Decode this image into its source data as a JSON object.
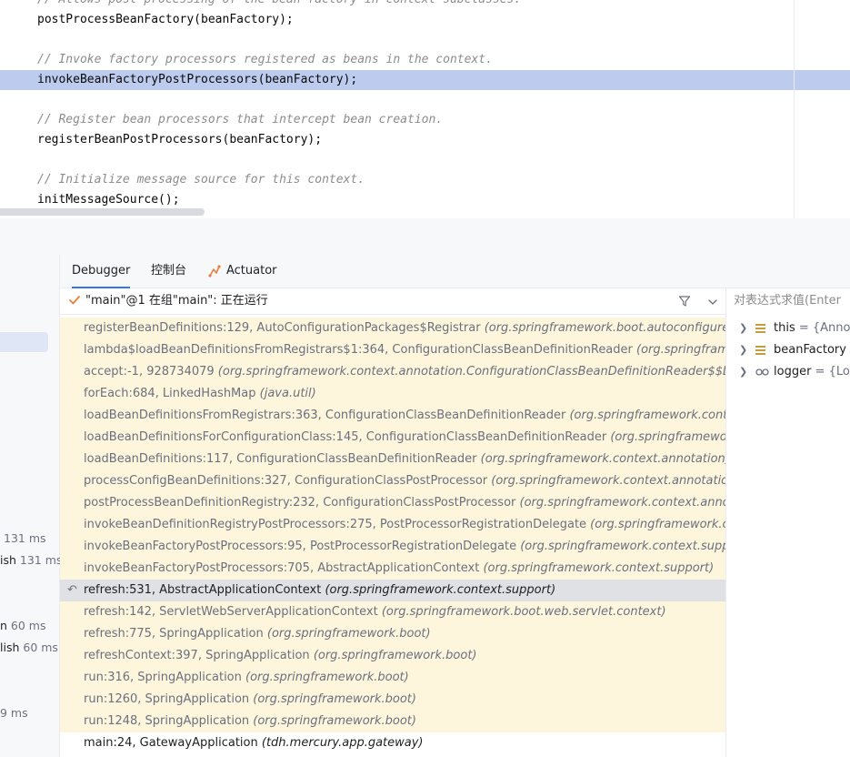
{
  "editor": {
    "lines": [
      {
        "text": "// Allows post-processing of the bean factory in context subclasses.",
        "type": "comment"
      },
      {
        "text": "postProcessBeanFactory(beanFactory);",
        "type": "code"
      },
      {
        "text": "// Invoke factory processors registered as beans in the context.",
        "type": "comment"
      },
      {
        "text": "invokeBeanFactoryPostProcessors(beanFactory);",
        "type": "code",
        "highlighted": true
      },
      {
        "text": "// Register bean processors that intercept bean creation.",
        "type": "comment"
      },
      {
        "text": "registerBeanPostProcessors(beanFactory);",
        "type": "code"
      },
      {
        "text": "// Initialize message source for this context.",
        "type": "comment"
      },
      {
        "text": "initMessageSource();",
        "type": "code"
      }
    ]
  },
  "tabs": [
    {
      "label": "Debugger",
      "active": true
    },
    {
      "label": "控制台",
      "active": false
    },
    {
      "label": "Actuator",
      "active": false
    }
  ],
  "thread": {
    "label": "\"main\"@1 在组\"main\": 正在运行"
  },
  "left_panel": {
    "timings": [
      {
        "prefix": "",
        "ms": "131 ms"
      },
      {
        "prefix": "ish",
        "ms": "131 ms"
      },
      {
        "prefix": "n",
        "ms": "60 ms"
      },
      {
        "prefix": "lish",
        "ms": "60 ms"
      },
      {
        "prefix": "",
        "ms": "9 ms"
      }
    ]
  },
  "frames": [
    {
      "method": "registerBeanDefinitions:129, AutoConfigurationPackages$Registrar ",
      "package": "(org.springframework.boot.autoconfigure)",
      "kind": "lib"
    },
    {
      "method": "lambda$loadBeanDefinitionsFromRegistrars$1:364, ConfigurationClassBeanDefinitionReader ",
      "package": "(org.springframework.context.annotation)",
      "kind": "lib"
    },
    {
      "method": "accept:-1, 928734079 ",
      "package": "(org.springframework.context.annotation.ConfigurationClassBeanDefinitionReader$$Lambda)",
      "kind": "lib"
    },
    {
      "method": "forEach:684, LinkedHashMap ",
      "package": "(java.util)",
      "kind": "lib"
    },
    {
      "method": "loadBeanDefinitionsFromRegistrars:363, ConfigurationClassBeanDefinitionReader ",
      "package": "(org.springframework.context.annotation)",
      "kind": "lib"
    },
    {
      "method": "loadBeanDefinitionsForConfigurationClass:145, ConfigurationClassBeanDefinitionReader ",
      "package": "(org.springframework.context.annotation)",
      "kind": "lib"
    },
    {
      "method": "loadBeanDefinitions:117, ConfigurationClassBeanDefinitionReader ",
      "package": "(org.springframework.context.annotation)",
      "kind": "lib"
    },
    {
      "method": "processConfigBeanDefinitions:327, ConfigurationClassPostProcessor ",
      "package": "(org.springframework.context.annotation)",
      "kind": "lib"
    },
    {
      "method": "postProcessBeanDefinitionRegistry:232, ConfigurationClassPostProcessor ",
      "package": "(org.springframework.context.annotation)",
      "kind": "lib"
    },
    {
      "method": "invokeBeanDefinitionRegistryPostProcessors:275, PostProcessorRegistrationDelegate ",
      "package": "(org.springframework.context.support)",
      "kind": "lib"
    },
    {
      "method": "invokeBeanFactoryPostProcessors:95, PostProcessorRegistrationDelegate ",
      "package": "(org.springframework.context.support)",
      "kind": "lib"
    },
    {
      "method": "invokeBeanFactoryPostProcessors:705, AbstractApplicationContext ",
      "package": "(org.springframework.context.support)",
      "kind": "lib"
    },
    {
      "method": "refresh:531, AbstractApplicationContext ",
      "package": "(org.springframework.context.support)",
      "kind": "cur"
    },
    {
      "method": "refresh:142, ServletWebServerApplicationContext ",
      "package": "(org.springframework.boot.web.servlet.context)",
      "kind": "lib"
    },
    {
      "method": "refresh:775, SpringApplication ",
      "package": "(org.springframework.boot)",
      "kind": "lib"
    },
    {
      "method": "refreshContext:397, SpringApplication ",
      "package": "(org.springframework.boot)",
      "kind": "lib"
    },
    {
      "method": "run:316, SpringApplication ",
      "package": "(org.springframework.boot)",
      "kind": "lib"
    },
    {
      "method": "run:1260, SpringApplication ",
      "package": "(org.springframework.boot)",
      "kind": "lib"
    },
    {
      "method": "run:1248, SpringApplication ",
      "package": "(org.springframework.boot)",
      "kind": "lib"
    },
    {
      "method": "main:24, GatewayApplication ",
      "package": "(tdh.mercury.app.gateway)",
      "kind": "user"
    }
  ],
  "variables": {
    "eval_placeholder": "对表达式求值(Enter",
    "items": [
      {
        "name": "this",
        "value": " = {Annot",
        "icon": "field-icon",
        "icon_color": "#c59d3b"
      },
      {
        "name": "beanFactory",
        "value": " = ",
        "icon": "field-icon",
        "icon_color": "#c59d3b"
      },
      {
        "name": "logger",
        "value": " = {Log",
        "icon": "watch-icon",
        "icon_color": "#6c707e"
      }
    ]
  },
  "colors": {
    "accent": "#3574f0",
    "exec_line": "#bccbee",
    "library_frame_bg": "#fdf5dc",
    "current_frame_bg": "#dfe1e5",
    "thread_check": "#e8803b"
  }
}
